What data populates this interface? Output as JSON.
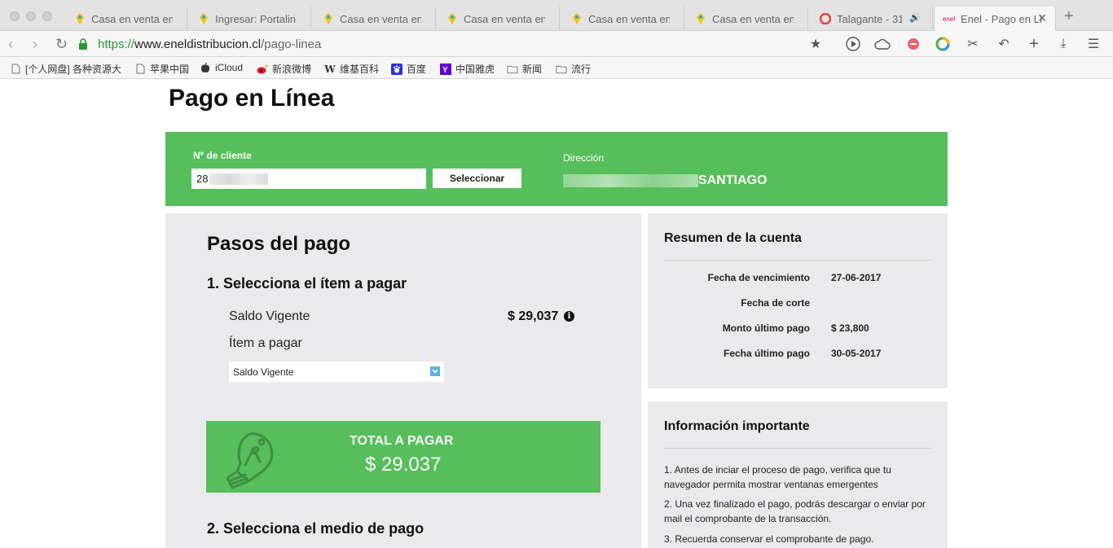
{
  "browser": {
    "tabs": [
      {
        "label": "Casa en venta en",
        "favicon": "pin-icon",
        "active": false
      },
      {
        "label": "Ingresar: Portalin",
        "favicon": "pin-icon",
        "active": false
      },
      {
        "label": "Casa en venta en",
        "favicon": "pin-icon",
        "active": false
      },
      {
        "label": "Casa en venta en",
        "favicon": "pin-icon",
        "active": false
      },
      {
        "label": "Casa en venta en",
        "favicon": "pin-icon",
        "active": false
      },
      {
        "label": "Casa en venta en",
        "favicon": "pin-icon",
        "active": false
      },
      {
        "label": "Talagante - 31",
        "favicon": "record-icon",
        "active": false
      },
      {
        "label": "Enel - Pago en Lí",
        "favicon": "enel-icon",
        "active": true
      }
    ],
    "url": {
      "protocol": "https://",
      "host": "www.eneldistribucion.cl",
      "path": "/pago-linea"
    },
    "bookmarks": [
      {
        "label": "[个人网盘] 各种资源大",
        "icon": "page-icon"
      },
      {
        "label": "苹果中国",
        "icon": "page-icon"
      },
      {
        "label": "iCloud",
        "icon": "apple-icon"
      },
      {
        "label": "新浪微博",
        "icon": "weibo-icon"
      },
      {
        "label": "维基百科",
        "icon": "wikipedia-icon"
      },
      {
        "label": "百度",
        "icon": "baidu-icon"
      },
      {
        "label": "中国雅虎",
        "icon": "yahoo-icon"
      },
      {
        "label": "新闻",
        "icon": "folder-icon"
      },
      {
        "label": "流行",
        "icon": "folder-icon"
      }
    ]
  },
  "page": {
    "title": "Pago en Línea",
    "client": {
      "label": "Nº de cliente",
      "value_prefix": "28",
      "select_button": "Seleccionar",
      "address_label": "Dirección",
      "address_city": "SANTIAGO"
    },
    "steps": {
      "title": "Pasos del pago",
      "step1_title": "1. Selecciona el ítem a pagar",
      "saldo_label": "Saldo Vigente",
      "saldo_value": "$ 29,037",
      "item_label": "Ítem a pagar",
      "item_selected": "Saldo Vigente",
      "total_label": "TOTAL A PAGAR",
      "total_value": "$ 29.037",
      "step2_title": "2. Selecciona el medio de pago"
    },
    "summary": {
      "title": "Resumen de la cuenta",
      "rows": [
        {
          "label": "Fecha de vencimiento",
          "value": "27-06-2017"
        },
        {
          "label": "Fecha de corte",
          "value": ""
        },
        {
          "label": "Monto último pago",
          "value": "$ 23,800"
        },
        {
          "label": "Fecha último pago",
          "value": "30-05-2017"
        }
      ]
    },
    "info": {
      "title": "Información importante",
      "items": [
        "1. Antes de inciar el proceso de pago, verifica que tu navegador permita mostrar ventanas emergentes",
        "2. Una vez finalizado el pago, podrás descargar o enviar por mail el comprobante de la transacción.",
        "3. Recuerda conservar el comprobante de pago."
      ]
    }
  },
  "colors": {
    "brand_green": "#56be5a",
    "panel_gray": "#eaeaec",
    "url_green": "#2b9a35"
  }
}
